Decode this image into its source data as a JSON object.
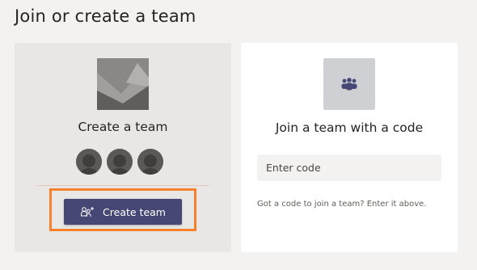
{
  "page": {
    "title": "Join or create a team"
  },
  "create_card": {
    "title": "Create a team",
    "button_label": "Create team",
    "image_icon": "mountain-landscape-icon",
    "button_icon": "add-people-icon",
    "avatar_count": 3
  },
  "join_card": {
    "title": "Join a team with a code",
    "input_placeholder": "Enter code",
    "input_value": "",
    "helper_text": "Got a code to join a team? Enter it above.",
    "image_icon": "team-people-icon"
  },
  "colors": {
    "background": "#f3f2f1",
    "button": "#464775",
    "highlight": "#f7812a",
    "create_card_bg": "#e8e7e5",
    "join_card_bg": "#ffffff"
  }
}
